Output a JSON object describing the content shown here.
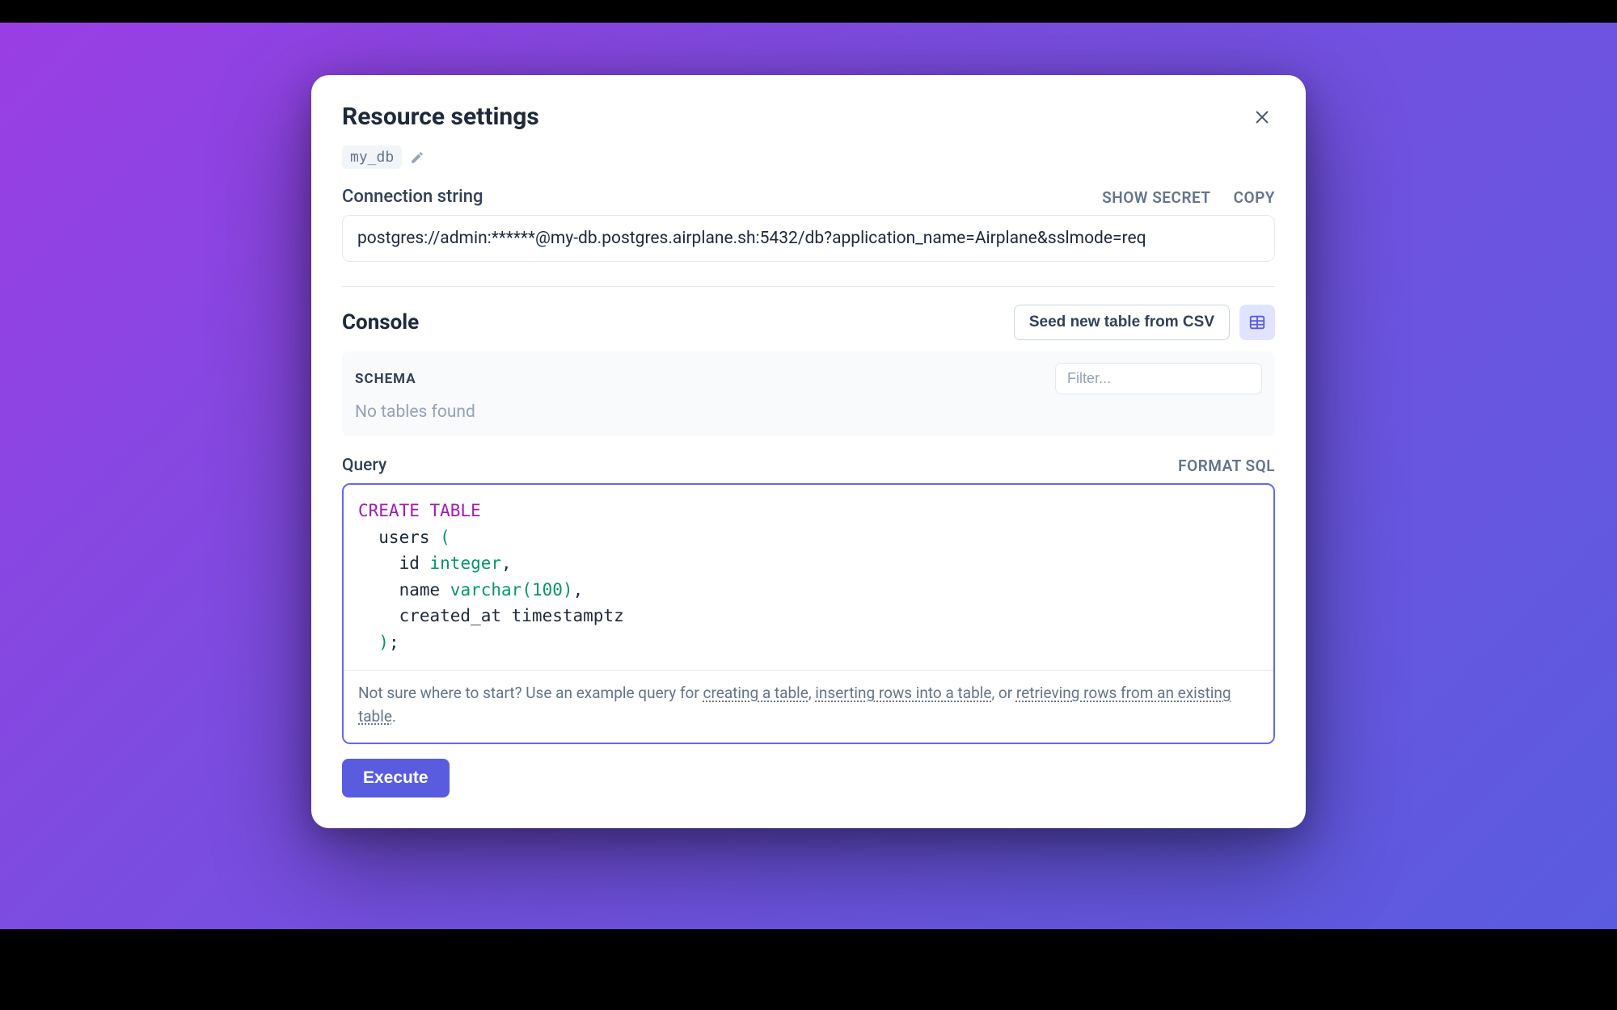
{
  "modal": {
    "title": "Resource settings",
    "db_name": "my_db"
  },
  "connection": {
    "label": "Connection string",
    "show_secret": "SHOW SECRET",
    "copy": "COPY",
    "value": "postgres://admin:******@my-db.postgres.airplane.sh:5432/db?application_name=Airplane&sslmode=req"
  },
  "console": {
    "title": "Console",
    "seed_label": "Seed new table from CSV",
    "schema_label": "SCHEMA",
    "filter_placeholder": "Filter...",
    "no_tables": "No tables found"
  },
  "query": {
    "label": "Query",
    "format_sql": "FORMAT SQL",
    "code_lines": [
      {
        "segments": [
          {
            "t": "CREATE TABLE",
            "c": "kw"
          }
        ]
      },
      {
        "segments": [
          {
            "t": "  users ",
            "c": ""
          },
          {
            "t": "(",
            "c": "pn"
          }
        ]
      },
      {
        "segments": [
          {
            "t": "    id ",
            "c": ""
          },
          {
            "t": "integer",
            "c": "ty"
          },
          {
            "t": ",",
            "c": ""
          }
        ]
      },
      {
        "segments": [
          {
            "t": "    name ",
            "c": ""
          },
          {
            "t": "varchar",
            "c": "ty"
          },
          {
            "t": "(",
            "c": "pn"
          },
          {
            "t": "100",
            "c": "nm"
          },
          {
            "t": ")",
            "c": "pn"
          },
          {
            "t": ",",
            "c": ""
          }
        ]
      },
      {
        "segments": [
          {
            "t": "    created_at timestamptz",
            "c": ""
          }
        ]
      },
      {
        "segments": [
          {
            "t": "  ",
            "c": ""
          },
          {
            "t": ")",
            "c": "pn"
          },
          {
            "t": ";",
            "c": ""
          }
        ]
      }
    ],
    "hint_prefix": "Not sure where to start? Use an example query for ",
    "hint_link1": "creating a table",
    "hint_sep1": ", ",
    "hint_link2": "inserting rows into a table",
    "hint_sep2": ", or ",
    "hint_link3": "retrieving rows from an existing table",
    "hint_suffix": "."
  },
  "execute_label": "Execute"
}
